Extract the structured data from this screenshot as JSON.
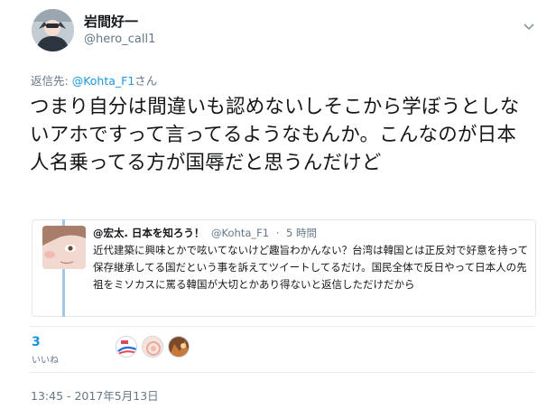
{
  "tweet": {
    "author": {
      "name": "岩間好一",
      "handle": "@hero_call1"
    },
    "reply_to": {
      "prefix": "返信先: ",
      "mention": "@Kohta_F1",
      "suffix": "さん"
    },
    "text": "つまり自分は間違いも認めないしそこから学ぼうとしないアホですって言ってるようなもんか。こんなのが日本人名乗ってる方が国辱だと思うんだけど",
    "quoted": {
      "name": "@宏太. 日本を知ろう！",
      "handle": "@Kohta_F1",
      "separator": "·",
      "time": "5 時間",
      "text": "近代建築に興味とかで呟いてないけど趣旨わかんない？台湾は韓国とは正反対で好意を持って保存継承してる国だという事を訴えてツイートしてるだけ。国民全体で反日やって日本人の先祖をミソカスに罵る韓国が大切とかあり得ないと返信しただけだから"
    },
    "likes": {
      "count": "3",
      "label": "いいね"
    },
    "timestamp": "13:45 - 2017年5月13日"
  },
  "colors": {
    "accent": "#1b95e0",
    "secondary_text": "#657786",
    "border": "#e1e8ed",
    "thread_line": "#9fc9e6"
  },
  "icons": {
    "menu": "chevron-down-icon"
  }
}
